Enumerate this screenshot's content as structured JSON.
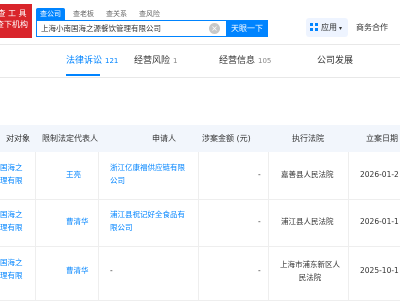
{
  "logo": {
    "line1": "查 工 具",
    "line2": "查下机构"
  },
  "search_tabs": [
    "查公司",
    "查老板",
    "查关系",
    "查风险"
  ],
  "search": {
    "value": "上海小南国海之源餐饮管理有限公司",
    "button": "天眼一下"
  },
  "header": {
    "app_label": "应用",
    "business_label": "商务合作"
  },
  "nav_tabs": [
    {
      "label": "法律诉讼",
      "count": "121"
    },
    {
      "label": "经营风险",
      "count": "1"
    },
    {
      "label": "经营信息",
      "count": "105"
    },
    {
      "label": "公司发展",
      "count": ""
    }
  ],
  "table": {
    "headers": [
      "对对象",
      "限制法定代表人",
      "申请人",
      "涉案金额 (元)",
      "执行法院",
      "立案日期"
    ],
    "rows": [
      {
        "target": [
          "国海之",
          "理有限"
        ],
        "rep": "王亮",
        "applicant": [
          "浙江亿康福供应链有限",
          "公司"
        ],
        "amount": "-",
        "court": [
          "嘉善县人民法院"
        ],
        "date": "2026-01-2"
      },
      {
        "target": [
          "国海之",
          "理有限"
        ],
        "rep": "曹清华",
        "applicant": [
          "浦江县祝记好全食品有",
          "限公司"
        ],
        "amount": "-",
        "court": [
          "浦江县人民法院"
        ],
        "date": "2026-01-1"
      },
      {
        "target": [
          "国海之",
          "理有限"
        ],
        "rep": "曹清华",
        "applicant": [
          "-"
        ],
        "amount": "-",
        "court": [
          "上海市浦东新区人",
          "民法院"
        ],
        "date": "2025-10-1"
      }
    ]
  },
  "colors": {
    "accent": "#0084ff",
    "logo": "#d9252b",
    "header_bg": "#f2f6fc"
  }
}
